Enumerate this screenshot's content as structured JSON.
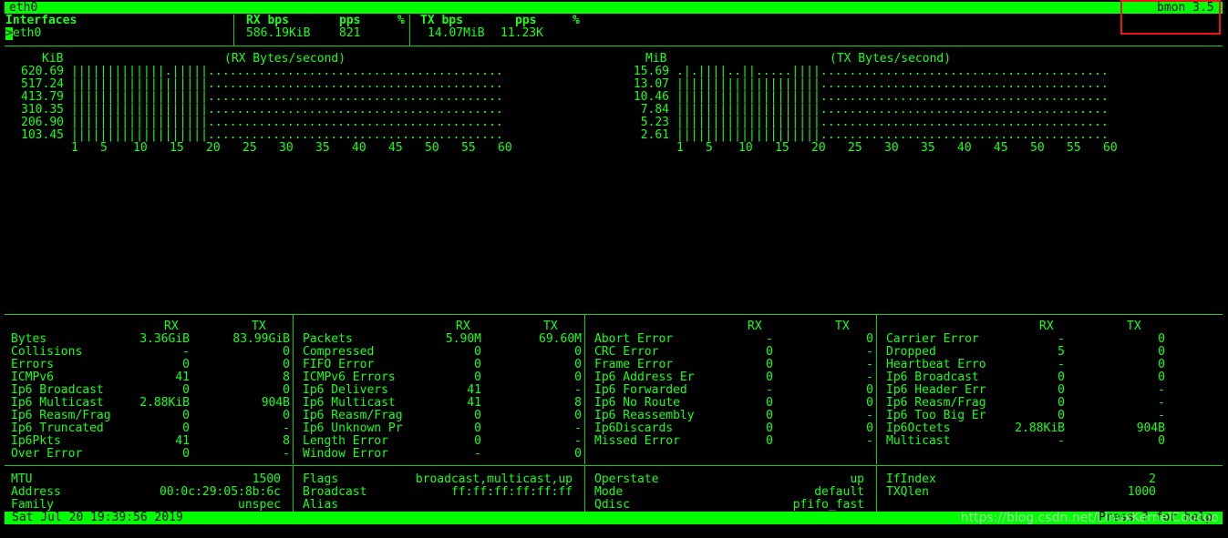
{
  "top_bar": {
    "left": "eth0",
    "right": "bmon 3.5"
  },
  "iface_table": {
    "col_interfaces": "Interfaces",
    "col_rx_bps": "RX bps",
    "col_rx_pps": "pps",
    "col_rx_pct": "%",
    "col_tx_bps": "TX bps",
    "col_tx_pps": "pps",
    "col_tx_pct": "%",
    "row_cursor": ">",
    "row_name": "eth0",
    "row_rx_bps": "586.19KiB",
    "row_rx_pps": "821",
    "row_tx_bps": "14.07MiB",
    "row_tx_pps": "11.23K"
  },
  "rx_graph": {
    "unit": "KiB",
    "title": "(RX Bytes/second)",
    "ylabels": [
      "620.69",
      "517.24",
      "413.79",
      "310.35",
      "206.90",
      "103.45"
    ],
    "rows": [
      "|||||||||||||.|||||.........................................",
      "|||||||||||||||||||.........................................",
      "|||||||||||||||||||.........................................",
      "|||||||||||||||||||.........................................",
      "|||||||||||||||||||.........................................",
      "|||||||||||||||||||........................................."
    ],
    "xticks": [
      "1",
      "5",
      "10",
      "15",
      "20",
      "25",
      "30",
      "35",
      "40",
      "45",
      "50",
      "55",
      "60"
    ]
  },
  "tx_graph": {
    "unit": "MiB",
    "title": "(TX Bytes/second)",
    "ylabels": [
      "15.69",
      "13.07",
      "10.46",
      "7.84",
      "5.23",
      "2.61"
    ],
    "rows": [
      ".|.||||..||.....||||........................................",
      "||||||||||||||||||||........................................",
      "||||||||||||||||||||........................................",
      "||||||||||||||||||||........................................",
      "||||||||||||||||||||........................................",
      "||||||||||||||||||||........................................"
    ],
    "xticks": [
      "1",
      "5",
      "10",
      "15",
      "20",
      "25",
      "30",
      "35",
      "40",
      "45",
      "50",
      "55",
      "60"
    ]
  },
  "stats": [
    {
      "header_rx": "RX",
      "header_tx": "TX",
      "rows": [
        {
          "name": "Bytes",
          "rx": "3.36GiB",
          "tx": "83.99GiB"
        },
        {
          "name": "Collisions",
          "rx": "-",
          "tx": "0"
        },
        {
          "name": "Errors",
          "rx": "0",
          "tx": "0"
        },
        {
          "name": "ICMPv6",
          "rx": "41",
          "tx": "8"
        },
        {
          "name": "Ip6 Broadcast",
          "rx": "0",
          "tx": "0"
        },
        {
          "name": "Ip6 Multicast",
          "rx": "2.88KiB",
          "tx": "904B"
        },
        {
          "name": "Ip6 Reasm/Frag",
          "rx": "0",
          "tx": "0"
        },
        {
          "name": "Ip6 Truncated",
          "rx": "0",
          "tx": "-"
        },
        {
          "name": "Ip6Pkts",
          "rx": "41",
          "tx": "8"
        },
        {
          "name": "Over Error",
          "rx": "0",
          "tx": "-"
        }
      ]
    },
    {
      "header_rx": "RX",
      "header_tx": "TX",
      "rows": [
        {
          "name": "Packets",
          "rx": "5.90M",
          "tx": "69.60M"
        },
        {
          "name": "Compressed",
          "rx": "0",
          "tx": "0"
        },
        {
          "name": "FIFO Error",
          "rx": "0",
          "tx": "0"
        },
        {
          "name": "ICMPv6 Errors",
          "rx": "0",
          "tx": "0"
        },
        {
          "name": "Ip6 Delivers",
          "rx": "41",
          "tx": "-"
        },
        {
          "name": "Ip6 Multicast",
          "rx": "41",
          "tx": "8"
        },
        {
          "name": "Ip6 Reasm/Frag",
          "rx": "0",
          "tx": "0"
        },
        {
          "name": "Ip6 Unknown Pr",
          "rx": "0",
          "tx": "-"
        },
        {
          "name": "Length Error",
          "rx": "0",
          "tx": "-"
        },
        {
          "name": "Window Error",
          "rx": "-",
          "tx": "0"
        }
      ]
    },
    {
      "header_rx": "RX",
      "header_tx": "TX",
      "rows": [
        {
          "name": "Abort Error",
          "rx": "-",
          "tx": "0"
        },
        {
          "name": "CRC Error",
          "rx": "0",
          "tx": "-"
        },
        {
          "name": "Frame Error",
          "rx": "0",
          "tx": "-"
        },
        {
          "name": "Ip6 Address Er",
          "rx": "0",
          "tx": "-"
        },
        {
          "name": "Ip6 Forwarded",
          "rx": "-",
          "tx": "0"
        },
        {
          "name": "Ip6 No Route",
          "rx": "0",
          "tx": "0"
        },
        {
          "name": "Ip6 Reassembly",
          "rx": "0",
          "tx": "-"
        },
        {
          "name": "Ip6Discards",
          "rx": "0",
          "tx": "0"
        },
        {
          "name": "Missed Error",
          "rx": "0",
          "tx": "-"
        }
      ]
    },
    {
      "header_rx": "RX",
      "header_tx": "TX",
      "rows": [
        {
          "name": "Carrier Error",
          "rx": "-",
          "tx": "0"
        },
        {
          "name": "Dropped",
          "rx": "5",
          "tx": "0"
        },
        {
          "name": "Heartbeat Erro",
          "rx": "-",
          "tx": "0"
        },
        {
          "name": "Ip6 Broadcast",
          "rx": "0",
          "tx": "0"
        },
        {
          "name": "Ip6 Header Err",
          "rx": "0",
          "tx": "-"
        },
        {
          "name": "Ip6 Reasm/Frag",
          "rx": "0",
          "tx": "-"
        },
        {
          "name": "Ip6 Too Big Er",
          "rx": "0",
          "tx": "-"
        },
        {
          "name": "Ip6Octets",
          "rx": "2.88KiB",
          "tx": "904B"
        },
        {
          "name": "Multicast",
          "rx": "-",
          "tx": "0"
        }
      ]
    }
  ],
  "info": [
    [
      {
        "k": "MTU",
        "v": "1500"
      },
      {
        "k": "Address",
        "v": "00:0c:29:05:8b:6c"
      },
      {
        "k": "Family",
        "v": "unspec"
      }
    ],
    [
      {
        "k": "Flags",
        "v": "broadcast,multicast,up"
      },
      {
        "k": "Broadcast",
        "v": "ff:ff:ff:ff:ff:ff"
      },
      {
        "k": "Alias",
        "v": ""
      }
    ],
    [
      {
        "k": "Operstate",
        "v": "up"
      },
      {
        "k": "Mode",
        "v": "default"
      },
      {
        "k": "Qdisc",
        "v": "pfifo_fast"
      }
    ],
    [
      {
        "k": "IfIndex",
        "v": "2"
      },
      {
        "k": "TXQlen",
        "v": "1000"
      }
    ]
  ],
  "status_bar": {
    "datetime": "Sat Jul 20 19:39:56 2019",
    "hint": "Press ? for help"
  },
  "watermark": "https://blog.csdn.net/LinuxKernelCoocoo"
}
